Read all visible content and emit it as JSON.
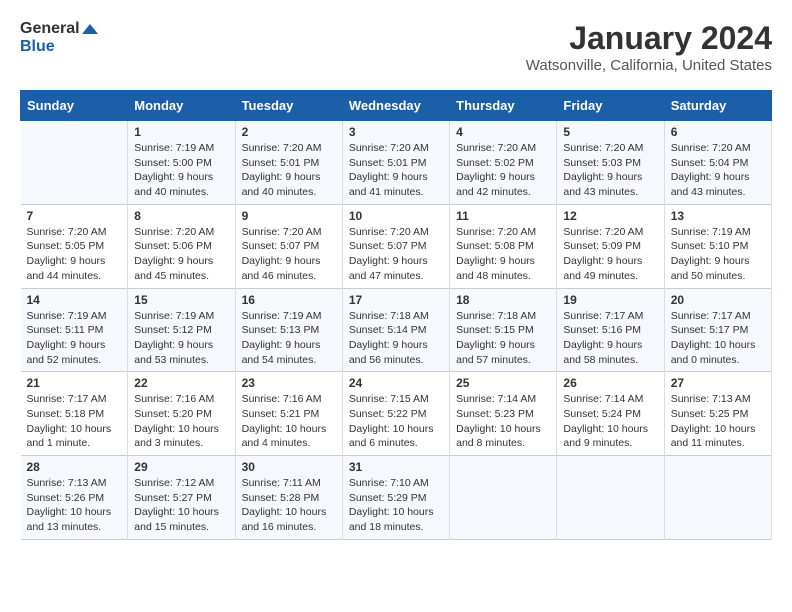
{
  "logo": {
    "line1": "General",
    "line2": "Blue"
  },
  "title": "January 2024",
  "subtitle": "Watsonville, California, United States",
  "days_of_week": [
    "Sunday",
    "Monday",
    "Tuesday",
    "Wednesday",
    "Thursday",
    "Friday",
    "Saturday"
  ],
  "weeks": [
    [
      {
        "day": "",
        "info": ""
      },
      {
        "day": "1",
        "info": "Sunrise: 7:19 AM\nSunset: 5:00 PM\nDaylight: 9 hours\nand 40 minutes."
      },
      {
        "day": "2",
        "info": "Sunrise: 7:20 AM\nSunset: 5:01 PM\nDaylight: 9 hours\nand 40 minutes."
      },
      {
        "day": "3",
        "info": "Sunrise: 7:20 AM\nSunset: 5:01 PM\nDaylight: 9 hours\nand 41 minutes."
      },
      {
        "day": "4",
        "info": "Sunrise: 7:20 AM\nSunset: 5:02 PM\nDaylight: 9 hours\nand 42 minutes."
      },
      {
        "day": "5",
        "info": "Sunrise: 7:20 AM\nSunset: 5:03 PM\nDaylight: 9 hours\nand 43 minutes."
      },
      {
        "day": "6",
        "info": "Sunrise: 7:20 AM\nSunset: 5:04 PM\nDaylight: 9 hours\nand 43 minutes."
      }
    ],
    [
      {
        "day": "7",
        "info": "Sunrise: 7:20 AM\nSunset: 5:05 PM\nDaylight: 9 hours\nand 44 minutes."
      },
      {
        "day": "8",
        "info": "Sunrise: 7:20 AM\nSunset: 5:06 PM\nDaylight: 9 hours\nand 45 minutes."
      },
      {
        "day": "9",
        "info": "Sunrise: 7:20 AM\nSunset: 5:07 PM\nDaylight: 9 hours\nand 46 minutes."
      },
      {
        "day": "10",
        "info": "Sunrise: 7:20 AM\nSunset: 5:07 PM\nDaylight: 9 hours\nand 47 minutes."
      },
      {
        "day": "11",
        "info": "Sunrise: 7:20 AM\nSunset: 5:08 PM\nDaylight: 9 hours\nand 48 minutes."
      },
      {
        "day": "12",
        "info": "Sunrise: 7:20 AM\nSunset: 5:09 PM\nDaylight: 9 hours\nand 49 minutes."
      },
      {
        "day": "13",
        "info": "Sunrise: 7:19 AM\nSunset: 5:10 PM\nDaylight: 9 hours\nand 50 minutes."
      }
    ],
    [
      {
        "day": "14",
        "info": "Sunrise: 7:19 AM\nSunset: 5:11 PM\nDaylight: 9 hours\nand 52 minutes."
      },
      {
        "day": "15",
        "info": "Sunrise: 7:19 AM\nSunset: 5:12 PM\nDaylight: 9 hours\nand 53 minutes."
      },
      {
        "day": "16",
        "info": "Sunrise: 7:19 AM\nSunset: 5:13 PM\nDaylight: 9 hours\nand 54 minutes."
      },
      {
        "day": "17",
        "info": "Sunrise: 7:18 AM\nSunset: 5:14 PM\nDaylight: 9 hours\nand 56 minutes."
      },
      {
        "day": "18",
        "info": "Sunrise: 7:18 AM\nSunset: 5:15 PM\nDaylight: 9 hours\nand 57 minutes."
      },
      {
        "day": "19",
        "info": "Sunrise: 7:17 AM\nSunset: 5:16 PM\nDaylight: 9 hours\nand 58 minutes."
      },
      {
        "day": "20",
        "info": "Sunrise: 7:17 AM\nSunset: 5:17 PM\nDaylight: 10 hours\nand 0 minutes."
      }
    ],
    [
      {
        "day": "21",
        "info": "Sunrise: 7:17 AM\nSunset: 5:18 PM\nDaylight: 10 hours\nand 1 minute."
      },
      {
        "day": "22",
        "info": "Sunrise: 7:16 AM\nSunset: 5:20 PM\nDaylight: 10 hours\nand 3 minutes."
      },
      {
        "day": "23",
        "info": "Sunrise: 7:16 AM\nSunset: 5:21 PM\nDaylight: 10 hours\nand 4 minutes."
      },
      {
        "day": "24",
        "info": "Sunrise: 7:15 AM\nSunset: 5:22 PM\nDaylight: 10 hours\nand 6 minutes."
      },
      {
        "day": "25",
        "info": "Sunrise: 7:14 AM\nSunset: 5:23 PM\nDaylight: 10 hours\nand 8 minutes."
      },
      {
        "day": "26",
        "info": "Sunrise: 7:14 AM\nSunset: 5:24 PM\nDaylight: 10 hours\nand 9 minutes."
      },
      {
        "day": "27",
        "info": "Sunrise: 7:13 AM\nSunset: 5:25 PM\nDaylight: 10 hours\nand 11 minutes."
      }
    ],
    [
      {
        "day": "28",
        "info": "Sunrise: 7:13 AM\nSunset: 5:26 PM\nDaylight: 10 hours\nand 13 minutes."
      },
      {
        "day": "29",
        "info": "Sunrise: 7:12 AM\nSunset: 5:27 PM\nDaylight: 10 hours\nand 15 minutes."
      },
      {
        "day": "30",
        "info": "Sunrise: 7:11 AM\nSunset: 5:28 PM\nDaylight: 10 hours\nand 16 minutes."
      },
      {
        "day": "31",
        "info": "Sunrise: 7:10 AM\nSunset: 5:29 PM\nDaylight: 10 hours\nand 18 minutes."
      },
      {
        "day": "",
        "info": ""
      },
      {
        "day": "",
        "info": ""
      },
      {
        "day": "",
        "info": ""
      }
    ]
  ]
}
